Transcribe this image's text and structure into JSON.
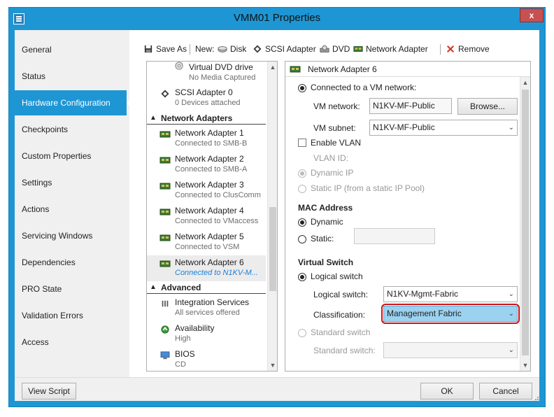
{
  "window": {
    "title": "VMM01 Properties",
    "close_label": "x"
  },
  "nav": {
    "items": [
      {
        "label": "General"
      },
      {
        "label": "Status"
      },
      {
        "label": "Hardware Configuration"
      },
      {
        "label": "Checkpoints"
      },
      {
        "label": "Custom Properties"
      },
      {
        "label": "Settings"
      },
      {
        "label": "Actions"
      },
      {
        "label": "Servicing Windows"
      },
      {
        "label": "Dependencies"
      },
      {
        "label": "PRO State"
      },
      {
        "label": "Validation Errors"
      },
      {
        "label": "Access"
      }
    ],
    "active_index": 2
  },
  "toolbar": {
    "save_as": "Save As",
    "new_label": "New:",
    "disk": "Disk",
    "scsi_adapter": "SCSI Adapter",
    "dvd": "DVD",
    "network_adapter": "Network Adapter",
    "remove": "Remove"
  },
  "hardware_list": {
    "dvd": {
      "title": "Virtual DVD drive",
      "sub": "No Media Captured"
    },
    "scsi": {
      "title": "SCSI Adapter 0",
      "sub": "0 Devices attached"
    },
    "network_group": "Network Adapters",
    "adapters": [
      {
        "title": "Network Adapter 1",
        "sub": "Connected to SMB-B"
      },
      {
        "title": "Network Adapter 2",
        "sub": "Connected to SMB-A"
      },
      {
        "title": "Network Adapter 3",
        "sub": "Connected to ClusComm"
      },
      {
        "title": "Network Adapter 4",
        "sub": "Connected to VMaccess"
      },
      {
        "title": "Network Adapter 5",
        "sub": "Connected to VSM"
      },
      {
        "title": "Network Adapter 6",
        "sub": "Connected to N1KV-M..."
      }
    ],
    "advanced_group": "Advanced",
    "integration": {
      "title": "Integration Services",
      "sub": "All services offered"
    },
    "availability": {
      "title": "Availability",
      "sub": "High"
    },
    "bios": {
      "title": "BIOS",
      "sub": "CD"
    }
  },
  "detail": {
    "header": "Network Adapter 6",
    "connected_vm_network": "Connected to a VM network:",
    "vm_network_label": "VM network:",
    "vm_network_value": "N1KV-MF-Public",
    "browse": "Browse...",
    "vm_subnet_label": "VM subnet:",
    "vm_subnet_value": "N1KV-MF-Public",
    "enable_vlan": "Enable VLAN",
    "vlan_id": "VLAN ID:",
    "dynamic_ip": "Dynamic IP",
    "static_ip": "Static IP (from a static IP Pool)",
    "mac_header": "MAC Address",
    "mac_dynamic": "Dynamic",
    "mac_static": "Static:",
    "vswitch_header": "Virtual Switch",
    "logical_switch_radio": "Logical switch",
    "logical_switch_label": "Logical switch:",
    "logical_switch_value": "N1KV-Mgmt-Fabric",
    "classification_label": "Classification:",
    "classification_value": "Management Fabric",
    "standard_switch_radio": "Standard switch",
    "standard_switch_label": "Standard switch:"
  },
  "footer": {
    "view_script": "View Script",
    "ok": "OK",
    "cancel": "Cancel"
  },
  "colors": {
    "accent": "#1e96d4",
    "highlight": "#9bd2f0",
    "annotation": "#c8161d",
    "close": "#c75050"
  }
}
